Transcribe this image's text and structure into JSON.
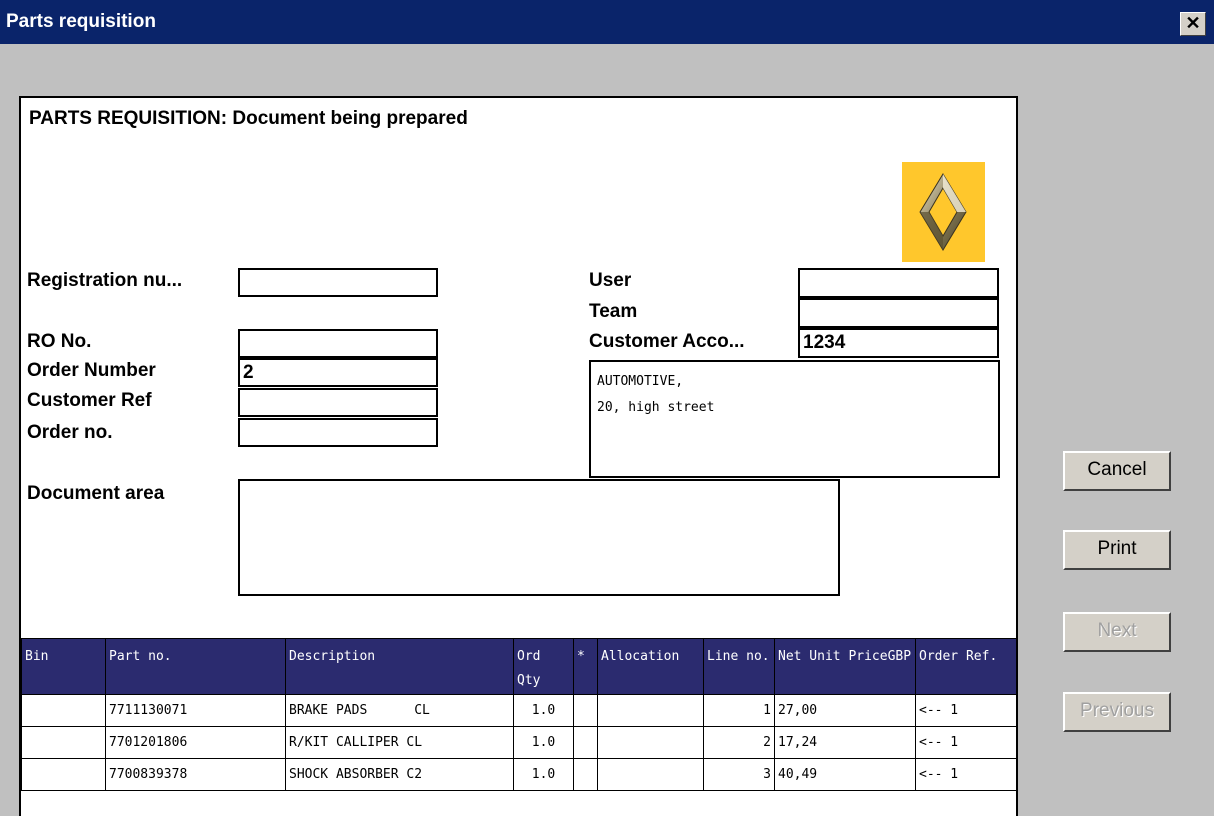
{
  "window": {
    "title": "Parts requisition",
    "close_glyph": "✕"
  },
  "document": {
    "heading": "PARTS REQUISITION: Document being prepared",
    "logo": {
      "name": "renault-logo",
      "bg_color": "#ffc72c"
    },
    "fields": {
      "registration_label": "Registration nu...",
      "registration_value": "",
      "ro_label": "RO No.",
      "ro_value": "",
      "order_number_label": "Order Number",
      "order_number_value": "2",
      "customer_ref_label": "Customer Ref",
      "customer_ref_value": "",
      "order_no_label": "Order no.",
      "order_no_value": "",
      "user_label": "User",
      "user_value": "",
      "team_label": "Team",
      "team_value": "",
      "customer_account_label": "Customer Acco...",
      "customer_account_value": "1234",
      "document_area_label": "Document area"
    },
    "address_lines": [
      "AUTOMOTIVE,",
      "20, high street"
    ]
  },
  "table": {
    "header_color": "#2b2b6f",
    "columns": [
      "Bin",
      "Part no.",
      "Description",
      "Ord Qty",
      "*",
      "Allocation",
      "Line no.",
      "Net Unit PriceGBP",
      "Order Ref."
    ],
    "rows": [
      {
        "bin": "",
        "part_no": "7711130071",
        "description": "BRAKE PADS      CL",
        "ord_qty": "1.0",
        "star": "",
        "allocation": "",
        "line_no": "1",
        "price": "27,00",
        "order_ref": "<-- 1"
      },
      {
        "bin": "",
        "part_no": "7701201806",
        "description": "R/KIT CALLIPER CL",
        "ord_qty": "1.0",
        "star": "",
        "allocation": "",
        "line_no": "2",
        "price": "17,24",
        "order_ref": "<-- 1"
      },
      {
        "bin": "",
        "part_no": "7700839378",
        "description": "SHOCK ABSORBER C2",
        "ord_qty": "1.0",
        "star": "",
        "allocation": "",
        "line_no": "3",
        "price": "40,49",
        "order_ref": "<-- 1"
      }
    ]
  },
  "buttons": {
    "cancel": "Cancel",
    "print": "Print",
    "next": "Next",
    "previous": "Previous"
  }
}
